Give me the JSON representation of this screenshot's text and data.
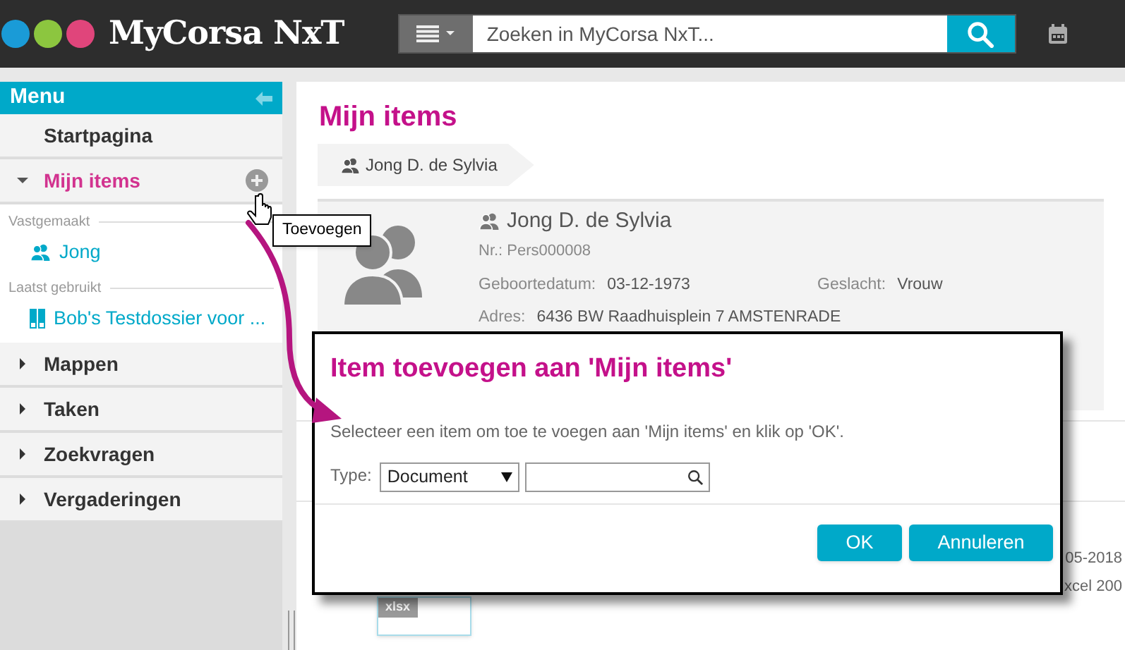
{
  "header": {
    "logo_text": "MyCorsa NxT",
    "search": {
      "placeholder": "Zoeken in MyCorsa NxT..."
    }
  },
  "sidebar": {
    "title": "Menu",
    "items": [
      {
        "label": "Startpagina",
        "kind": "link",
        "selected": false
      },
      {
        "label": "Mijn items",
        "kind": "section",
        "expanded": true,
        "selected": true,
        "groups": [
          {
            "label": "Vastgemaakt",
            "items": [
              {
                "label": "Jong",
                "kind": "person"
              }
            ]
          },
          {
            "label": "Laatst gebruikt",
            "items": [
              {
                "label": "Bob's Testdossier voor ...",
                "kind": "dossier"
              }
            ]
          }
        ]
      },
      {
        "label": "Mappen",
        "kind": "section",
        "expanded": false,
        "selected": false
      },
      {
        "label": "Taken",
        "kind": "section",
        "expanded": false,
        "selected": false
      },
      {
        "label": "Zoekvragen",
        "kind": "section",
        "expanded": false,
        "selected": false
      },
      {
        "label": "Vergaderingen",
        "kind": "section",
        "expanded": false,
        "selected": false
      }
    ]
  },
  "tooltip": "Toevoegen",
  "main": {
    "title": "Mijn items",
    "breadcrumb": [
      "Jong D. de Sylvia"
    ],
    "card": {
      "name": "Jong D. de Sylvia",
      "number": "Nr.: Pers000008",
      "fields": [
        {
          "label": "Geboortedatum:",
          "value": "03-12-1973"
        },
        {
          "label": "Geslacht:",
          "value": "Vrouw"
        },
        {
          "label": "Adres:",
          "value": "6436 BW Raadhuisplein 7 AMSTENRADE"
        }
      ]
    },
    "partial_texts": [
      "05-2018",
      "xcel 200"
    ],
    "file_badge": "xlsx"
  },
  "dialog": {
    "title": "Item toevoegen aan 'Mijn items'",
    "message": "Selecteer een item om toe te voegen aan 'Mijn items' en klik op 'OK'.",
    "type_label": "Type:",
    "type_value": "Document",
    "buttons": [
      "OK",
      "Annuleren"
    ]
  }
}
